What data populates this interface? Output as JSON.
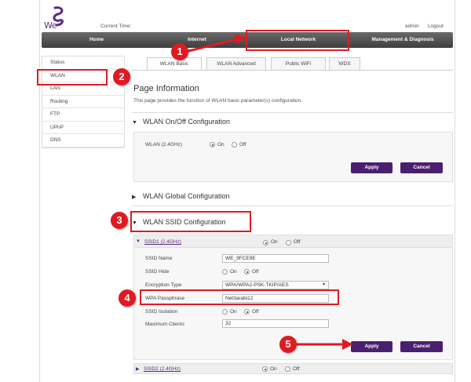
{
  "header": {
    "logo_text": "We",
    "current_time_label": "Current Time:",
    "admin_link": "admin",
    "logout_link": "Logout"
  },
  "topnav": [
    "Home",
    "Internet",
    "Local Network",
    "Management & Diagnosis"
  ],
  "sidebar": [
    "Status",
    "WLAN",
    "LAN",
    "Routing",
    "FTP",
    "UPnP",
    "DNS"
  ],
  "tabs": [
    "WLAN Basic",
    "WLAN Advanced",
    "Public WiFi",
    "WDS"
  ],
  "page_info": {
    "title": "Page Information",
    "description": "This page provides the function of WLAN basic parameter(s) configuration."
  },
  "onoff": {
    "title": "WLAN On/Off Configuration",
    "wlan_label": "WLAN (2.4GHz)",
    "on": "On",
    "off": "Off",
    "apply": "Apply",
    "cancel": "Cancel"
  },
  "global": {
    "title": "WLAN Global Configuration"
  },
  "ssid": {
    "title": "WLAN SSID Configuration",
    "ssid1_label": "SSID1 (2.4GHz)",
    "ssid2_label": "SSID2 (2.4GHz)",
    "on": "On",
    "off": "Off",
    "ssid_name_label": "SSID Name",
    "ssid_name_value": "WE_9FCE9E",
    "ssid_hide_label": "SSID Hide",
    "encryption_label": "Encryption Type",
    "encryption_value": "WPA/WPA2-PSK-TKIP/AES",
    "passphrase_label": "WPA Passphrase",
    "passphrase_value": "Net3arabi12",
    "isolation_label": "SSID Isolation",
    "max_clients_label": "Maximum Clients",
    "max_clients_value": "32",
    "apply": "Apply",
    "cancel": "Cancel"
  },
  "annotations": [
    "1",
    "2",
    "3",
    "4",
    "5"
  ],
  "colors": {
    "accent": "#4a1f6f",
    "annotation": "#e01a22"
  }
}
